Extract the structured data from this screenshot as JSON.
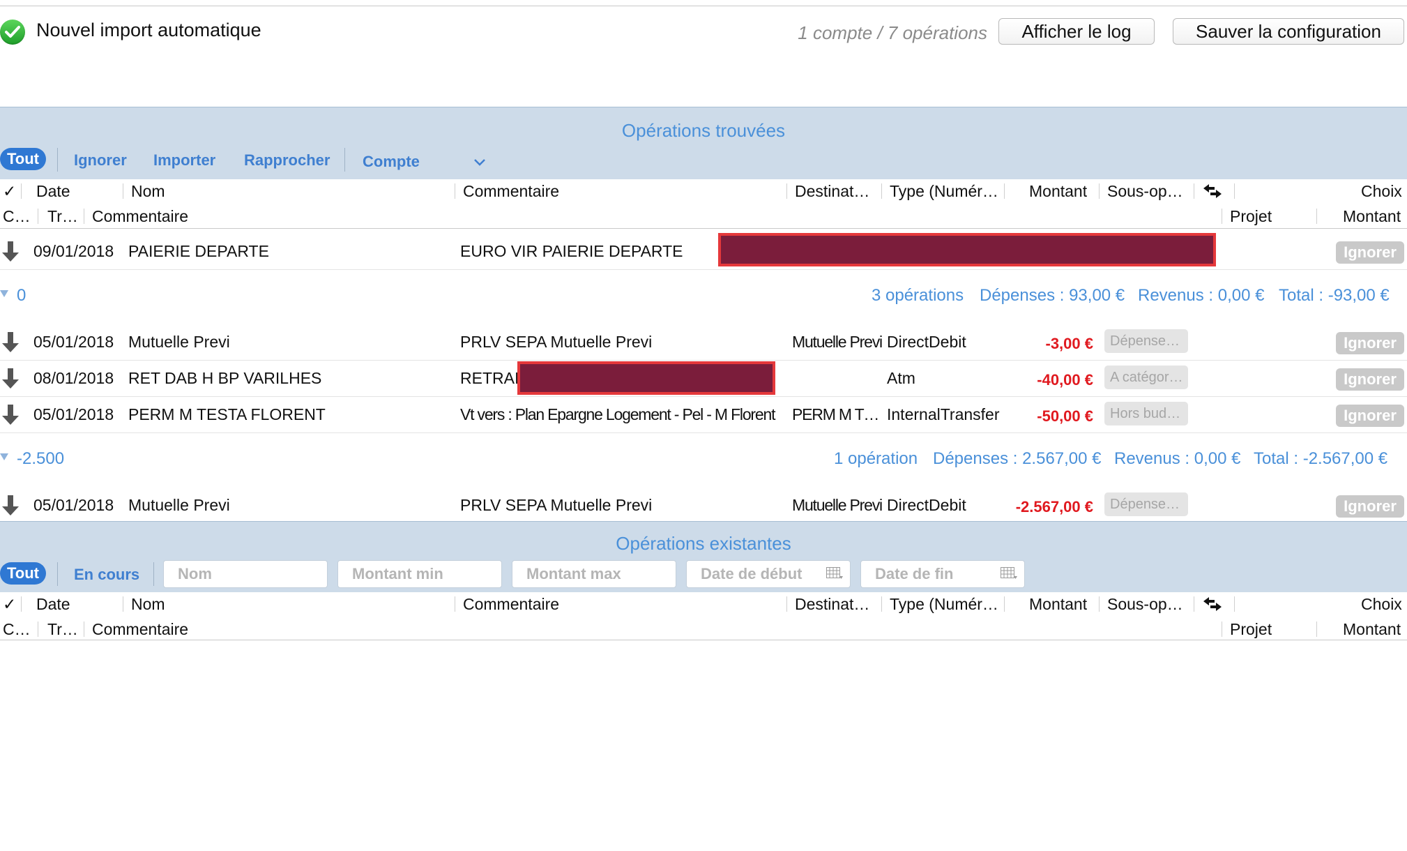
{
  "header": {
    "title": "Nouvel import automatique",
    "counts": "1 compte / 7 opérations",
    "log_button": "Afficher le log",
    "save_button": "Sauver la configuration"
  },
  "found": {
    "title": "Opérations trouvées",
    "filters": {
      "all": "Tout",
      "ignore": "Ignorer",
      "import": "Importer",
      "reconcile": "Rapprocher",
      "account": "Compte"
    },
    "columns": {
      "check": "✓",
      "date": "Date",
      "name": "Nom",
      "comment": "Commentaire",
      "recipient": "Destinat…",
      "type": "Type (Numér…",
      "amount": "Montant",
      "subop": "Sous-op…",
      "choice": "Choix",
      "cat": "C…",
      "tr": "Tr…",
      "comment2": "Commentaire",
      "project": "Projet",
      "amount2": "Montant"
    },
    "first_row": {
      "date": "09/01/2018",
      "name": "PAIERIE DEPARTE",
      "comment": "EURO VIR PAIERIE DEPARTE",
      "action": "Ignorer"
    },
    "groups": [
      {
        "label": "0",
        "ops": "3 opérations",
        "expenses": "Dépenses : 93,00 €",
        "income": "Revenus : 0,00 €",
        "total": "Total : -93,00 €",
        "rows": [
          {
            "date": "05/01/2018",
            "name": "Mutuelle Previ",
            "comment": "PRLV SEPA Mutuelle Previ",
            "recipient": "Mutuelle Previ",
            "type": "DirectDebit",
            "amount": "-3,00 €",
            "category": "Dépense…",
            "action": "Ignorer"
          },
          {
            "date": "08/01/2018",
            "name": "RET DAB H BP VARILHES",
            "comment": "RETRAIT",
            "recipient": "",
            "type": "Atm",
            "amount": "-40,00 €",
            "category": "A catégor…",
            "action": "Ignorer"
          },
          {
            "date": "05/01/2018",
            "name": "PERM M TESTA FLORENT",
            "comment": "Vt vers : Plan Epargne Logement - Pel - M Florent T…",
            "recipient": "PERM M T…",
            "type": "InternalTransfer",
            "amount": "-50,00 €",
            "category": "Hors bud…",
            "action": "Ignorer"
          }
        ]
      },
      {
        "label": "-2.500",
        "ops": "1 opération",
        "expenses": "Dépenses : 2.567,00 €",
        "income": "Revenus : 0,00 €",
        "total": "Total : -2.567,00 €",
        "rows": [
          {
            "date": "05/01/2018",
            "name": "Mutuelle Previ",
            "comment": "PRLV SEPA Mutuelle Previ",
            "recipient": "Mutuelle Previ",
            "type": "DirectDebit",
            "amount": "-2.567,00 €",
            "category": "Dépense…",
            "action": "Ignorer"
          }
        ]
      }
    ]
  },
  "existing": {
    "title": "Opérations existantes",
    "filters": {
      "all": "Tout",
      "pending": "En cours"
    },
    "fields": {
      "name": "Nom",
      "amount_min": "Montant min",
      "amount_max": "Montant max",
      "date_start": "Date de début",
      "date_end": "Date de fin"
    }
  },
  "colors": {
    "band": "#cddbe9",
    "accent": "#3f7fd0",
    "negative": "#e0191f",
    "redaction": "#7b1d3b"
  }
}
